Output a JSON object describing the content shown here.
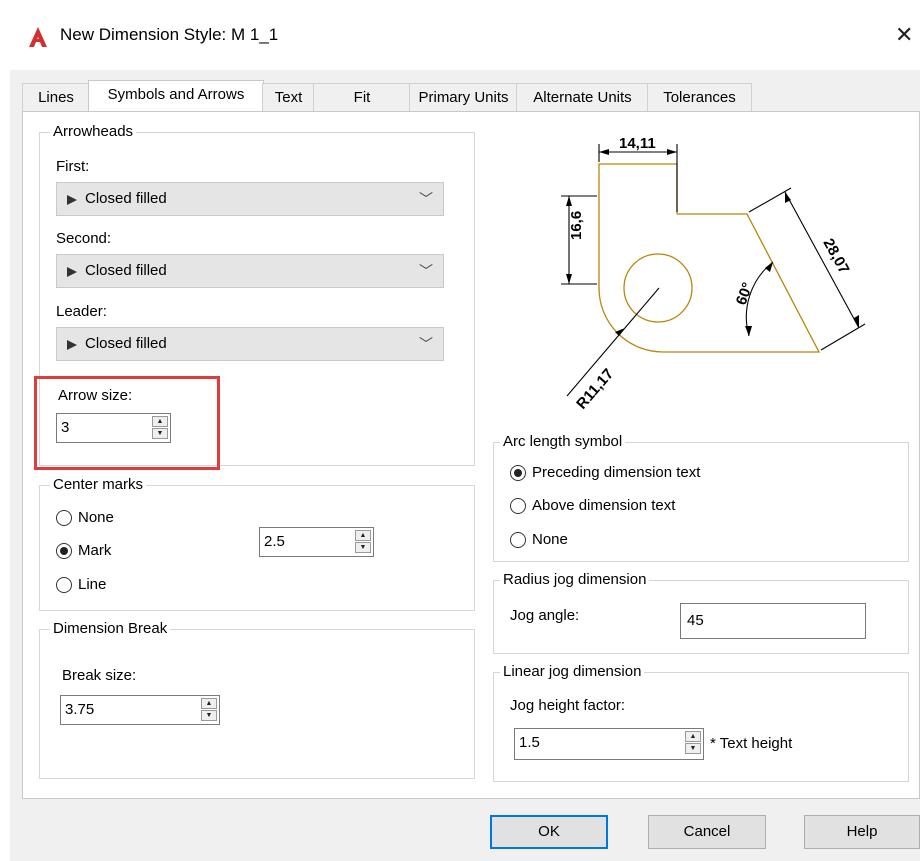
{
  "window": {
    "title": "New Dimension Style: M 1_1",
    "close_icon": "close-icon"
  },
  "tabs": [
    {
      "label": "Lines"
    },
    {
      "label": "Symbols and Arrows",
      "active": true
    },
    {
      "label": "Text"
    },
    {
      "label": "Fit"
    },
    {
      "label": "Primary Units"
    },
    {
      "label": "Alternate Units"
    },
    {
      "label": "Tolerances"
    }
  ],
  "arrowheads": {
    "title": "Arrowheads",
    "first_label": "First:",
    "first_value": "Closed filled",
    "second_label": "Second:",
    "second_value": "Closed filled",
    "leader_label": "Leader:",
    "leader_value": "Closed filled",
    "size_label": "Arrow size:",
    "size_value": "3"
  },
  "center_marks": {
    "title": "Center marks",
    "options": [
      "None",
      "Mark",
      "Line"
    ],
    "selected": "Mark",
    "size_value": "2.5"
  },
  "dimension_break": {
    "title": "Dimension Break",
    "size_label": "Break size:",
    "size_value": "3.75"
  },
  "arc_length": {
    "title": "Arc length symbol",
    "options": [
      "Preceding dimension text",
      "Above dimension text",
      "None"
    ],
    "selected": "Preceding dimension text"
  },
  "radius_jog": {
    "title": "Radius jog dimension",
    "angle_label": "Jog angle:",
    "angle_value": "45"
  },
  "linear_jog": {
    "title": "Linear jog dimension",
    "factor_label": "Jog height factor:",
    "factor_value": "1.5",
    "suffix": "* Text height"
  },
  "preview": {
    "dim_top": "14,11",
    "dim_left": "16,6",
    "dim_right": "28,07",
    "dim_angle": "60°",
    "dim_radius": "R11,17"
  },
  "buttons": {
    "ok": "OK",
    "cancel": "Cancel",
    "help": "Help"
  },
  "colors": {
    "highlight": "#e03c3c",
    "default_button_border": "#0078d7",
    "preview_geometry": "#b8860b",
    "logo": "#d32f2f"
  }
}
